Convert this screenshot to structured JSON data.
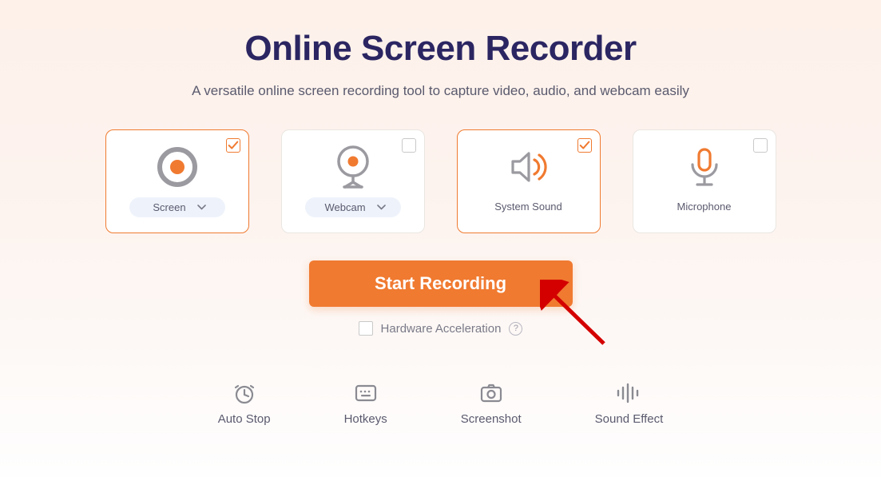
{
  "header": {
    "title": "Online Screen Recorder",
    "subtitle": "A versatile online screen recording tool to capture video, audio, and webcam easily"
  },
  "sources": {
    "screen": {
      "label": "Screen",
      "selected": true,
      "has_dropdown": true
    },
    "webcam": {
      "label": "Webcam",
      "selected": false,
      "has_dropdown": true
    },
    "system_sound": {
      "label": "System Sound",
      "selected": true,
      "has_dropdown": false
    },
    "microphone": {
      "label": "Microphone",
      "selected": false,
      "has_dropdown": false
    }
  },
  "actions": {
    "start_label": "Start Recording",
    "hw_accel_label": "Hardware Acceleration",
    "hw_accel_checked": false
  },
  "tools": {
    "auto_stop": "Auto Stop",
    "hotkeys": "Hotkeys",
    "screenshot": "Screenshot",
    "sound_effect": "Sound Effect"
  },
  "colors": {
    "accent": "#f07a30",
    "heading": "#2b2662"
  }
}
